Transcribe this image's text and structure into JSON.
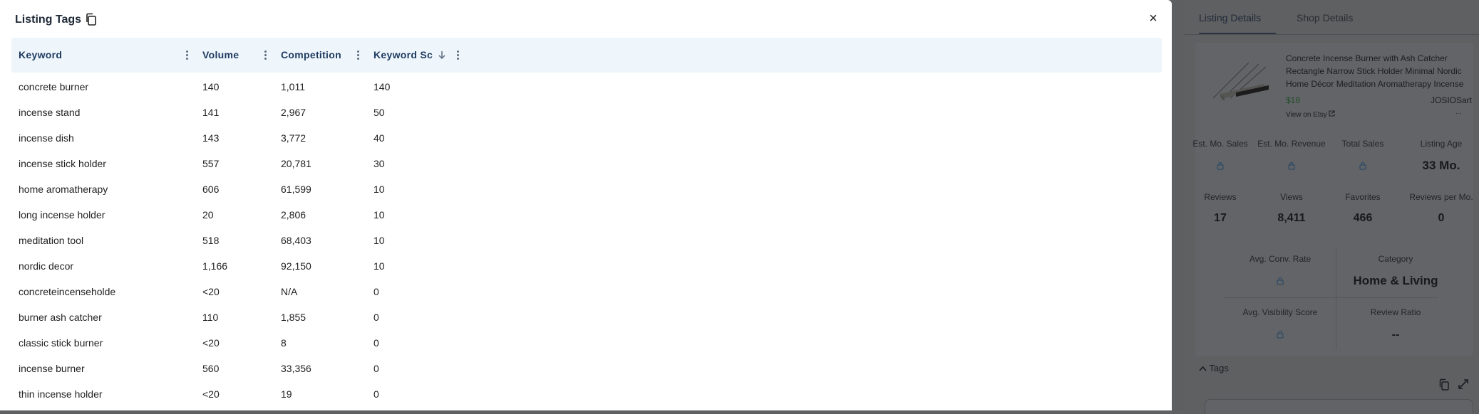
{
  "modal": {
    "title": "Listing Tags",
    "close_label": "×"
  },
  "table": {
    "columns": [
      {
        "label": "Keyword"
      },
      {
        "label": "Volume"
      },
      {
        "label": "Competition"
      },
      {
        "label": "Keyword Sc"
      }
    ],
    "rows": [
      {
        "keyword": "concrete burner",
        "volume": "140",
        "competition": "1,011",
        "score": "140"
      },
      {
        "keyword": "incense stand",
        "volume": "141",
        "competition": "2,967",
        "score": "50"
      },
      {
        "keyword": "incense dish",
        "volume": "143",
        "competition": "3,772",
        "score": "40"
      },
      {
        "keyword": "incense stick holder",
        "volume": "557",
        "competition": "20,781",
        "score": "30"
      },
      {
        "keyword": "home aromatherapy",
        "volume": "606",
        "competition": "61,599",
        "score": "10"
      },
      {
        "keyword": "long incense holder",
        "volume": "20",
        "competition": "2,806",
        "score": "10"
      },
      {
        "keyword": "meditation tool",
        "volume": "518",
        "competition": "68,403",
        "score": "10"
      },
      {
        "keyword": "nordic decor",
        "volume": "1,166",
        "competition": "92,150",
        "score": "10"
      },
      {
        "keyword": "concreteincenseholde",
        "volume": "<20",
        "competition": "N/A",
        "score": "0"
      },
      {
        "keyword": "burner ash catcher",
        "volume": "110",
        "competition": "1,855",
        "score": "0"
      },
      {
        "keyword": "classic stick burner",
        "volume": "<20",
        "competition": "8",
        "score": "0"
      },
      {
        "keyword": "incense burner",
        "volume": "560",
        "competition": "33,356",
        "score": "0"
      },
      {
        "keyword": "thin incense holder",
        "volume": "<20",
        "competition": "19",
        "score": "0"
      }
    ]
  },
  "side": {
    "tabs": [
      {
        "label": "Listing Details"
      },
      {
        "label": "Shop Details"
      }
    ],
    "product": {
      "title": "Concrete Incense Burner with Ash Catcher Rectangle Narrow Stick Holder Minimal Nordic Home Décor Meditation Aromatherapy Incense",
      "price": "$18",
      "shop": "JOSIOSart",
      "view_link": "View on Etsy",
      "more": "..."
    },
    "stats_row1": [
      {
        "label": "Est. Mo. Sales",
        "value": ""
      },
      {
        "label": "Est. Mo. Revenue",
        "value": ""
      },
      {
        "label": "Total Sales",
        "value": ""
      },
      {
        "label": "Listing Age",
        "value": "33 Mo."
      }
    ],
    "stats_row2": [
      {
        "label": "Reviews",
        "value": "17"
      },
      {
        "label": "Views",
        "value": "8,411"
      },
      {
        "label": "Favorites",
        "value": "466"
      },
      {
        "label": "Reviews per Mo.",
        "value": "0"
      }
    ],
    "stats_row3": [
      {
        "label": "Avg. Conv. Rate",
        "value": ""
      },
      {
        "label": "Category",
        "value": "Home & Living"
      }
    ],
    "stats_row4": [
      {
        "label": "Avg. Visibility Score",
        "value": ""
      },
      {
        "label": "Review Ratio",
        "value": "--"
      }
    ],
    "tags_label": "Tags"
  }
}
